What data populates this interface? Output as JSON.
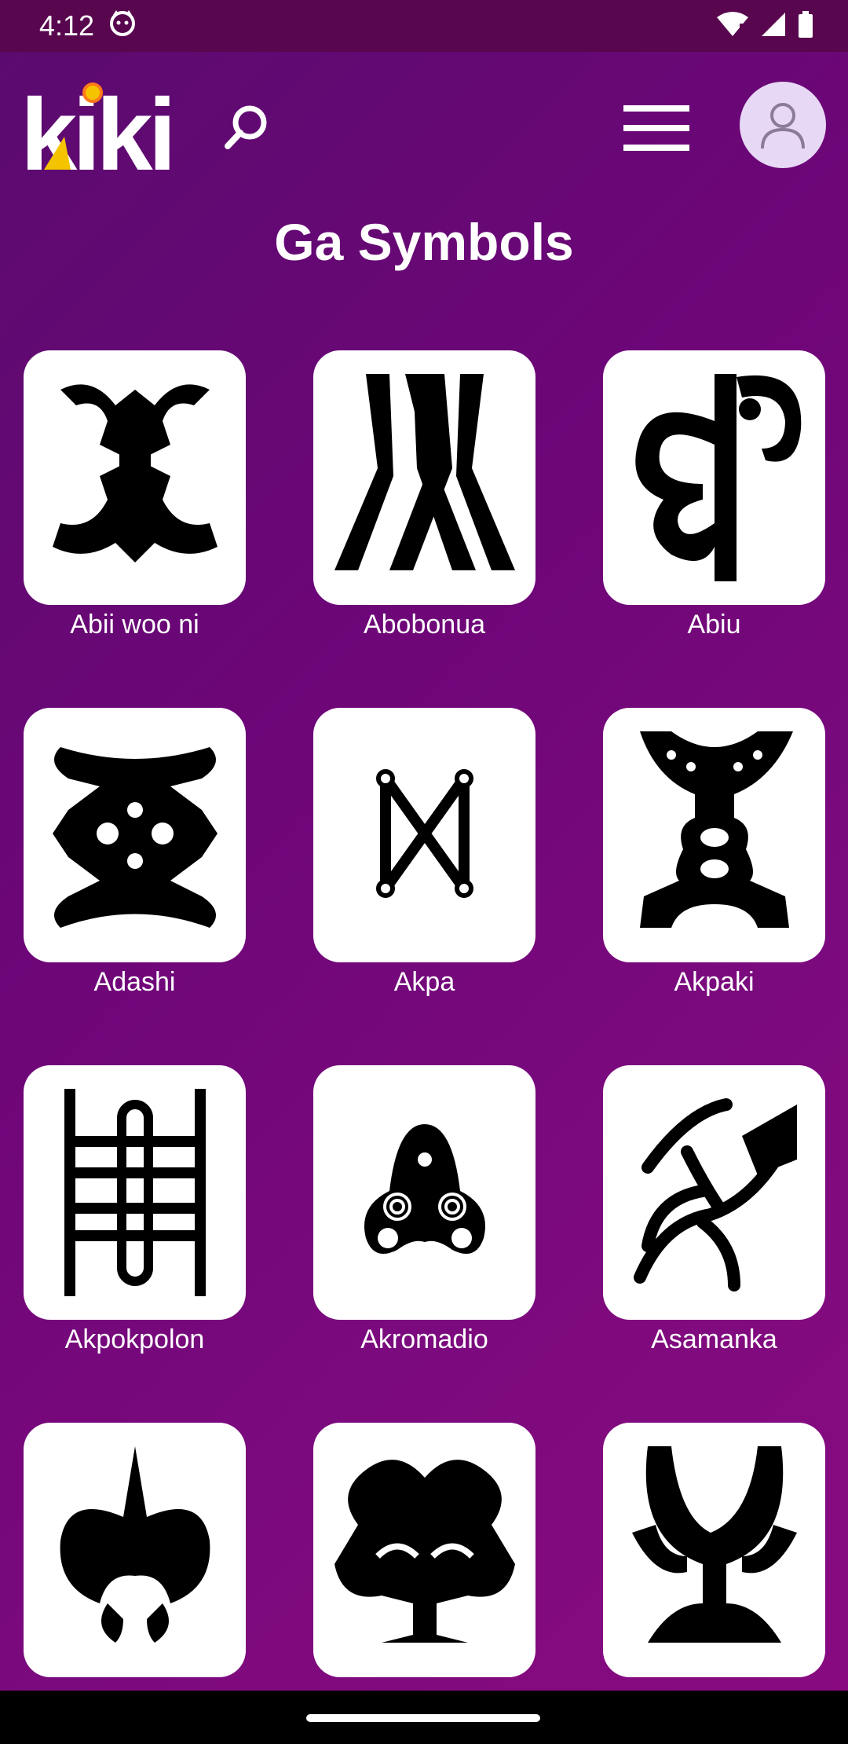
{
  "status": {
    "time": "4:12"
  },
  "header": {
    "logo_text": "kiki"
  },
  "page": {
    "title": "Ga Symbols"
  },
  "symbols": [
    {
      "label": "Abii woo ni"
    },
    {
      "label": "Abobonua"
    },
    {
      "label": "Abiu"
    },
    {
      "label": "Adashi"
    },
    {
      "label": "Akpa"
    },
    {
      "label": "Akpaki"
    },
    {
      "label": "Akpokpolon"
    },
    {
      "label": "Akromadio"
    },
    {
      "label": "Asamanka"
    },
    {
      "label": ""
    },
    {
      "label": ""
    },
    {
      "label": ""
    }
  ],
  "colors": {
    "bg_start": "#5a0b6f",
    "bg_end": "#8a0a80",
    "status_bar": "#58074f",
    "avatar_bg": "#e7d9f5",
    "logo_accent": "#f5c400"
  }
}
